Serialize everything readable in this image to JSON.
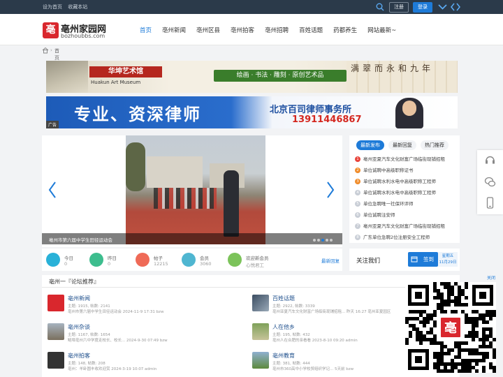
{
  "topbar": {
    "links": [
      "设为首页",
      "收藏本站"
    ],
    "register_label": "注册",
    "login_label": "登录"
  },
  "header": {
    "logo_char": "亳",
    "site_name": "亳州家园网",
    "domain": "bozhoubbs.com",
    "nav": [
      "首页",
      "亳州新闻",
      "亳州区县",
      "亳州拍客",
      "亳州招聘",
      "百姓话题",
      "药都养生",
      "网站最新~"
    ]
  },
  "breadcrumb": {
    "separator": "›",
    "current": "首页"
  },
  "banner1": {
    "brand": "华坤艺术馆",
    "brand_en": "Huakun Art Museum",
    "slogan": "绘画 · 书法 · 雕刻 · 原创艺术品",
    "calligraphy": "满翠而永和九年"
  },
  "banner2": {
    "headline": "专业、资深律师",
    "firm": "北京百司律师事务所",
    "phone": "13911446867",
    "ad_tag": "广告"
  },
  "carousel": {
    "caption": "亳州市第六届中学生田径运动会"
  },
  "stats": [
    {
      "label": "今日",
      "value": "0",
      "color": "#29b1d8"
    },
    {
      "label": "昨日",
      "value": "0",
      "color": "#3dbd8e"
    },
    {
      "label": "帖子",
      "value": "12215",
      "color": "#ef6a57"
    },
    {
      "label": "会员",
      "value": "3060",
      "color": "#4fb6d1"
    },
    {
      "label": "欢迎新会员",
      "value": "心悦君工",
      "color": "#7cc35a"
    }
  ],
  "stats_link": "最新回复",
  "right_panel": {
    "tabs": [
      "最新发布",
      "最新回复",
      "热门推荐"
    ],
    "items": [
      "亳州亚夏汽车文化财富广场临街现铺招租",
      "单位诚聘中高级职称证书",
      "单位诚聘水利水电中高级职称工程师",
      "单位诚聘水利水电中高级职称工程师",
      "单位急聘唯一社保环评师",
      "单位诚聘注安师",
      "亳州亚夏汽车文化财富广场临街现铺招租",
      "广东单位急聘2位注册安全工程师"
    ]
  },
  "follow": {
    "title": "关注我们",
    "signin_label": "签到",
    "weekday": "星期五",
    "date": "11月29日"
  },
  "forum": {
    "heading": "亳州一『论坛推荐』",
    "items": [
      {
        "title": "亳州新闻",
        "meta": "主题: 1915, 帖数: 2141",
        "last": "亳州市第六届中学生田径运动会 2024-11-9 17:31 bzw"
      },
      {
        "title": "百姓话题",
        "meta": "主题: 2922, 帖数: 3339",
        "last": "亳州亚夏汽车文化财富广场临街现铺招租... 昨天 16:27 亳州亚夏园区"
      },
      {
        "title": "亳州杂谈",
        "meta": "主题: 1167, 帖数: 1654",
        "last": "鲢埠亳州六中学度走校长、校长... 2024-9-30 07:49 bzw"
      },
      {
        "title": "人在他乡",
        "meta": "主题: 195, 帖数: 432",
        "last": "亳州人在合肥的亲看看 2023-8-10 09:20 admin"
      },
      {
        "title": "亳州拍客",
        "meta": "主题: 148, 帖数: 208",
        "last": "亳州：羊卧圆丰收欢迎赏 2024-3-19 10:07 admin"
      },
      {
        "title": "亳州教育",
        "meta": "主题: 381, 帖数: 444",
        "last": "亳州市360高中小学校贸组织学记... 5天前 bzw"
      }
    ]
  },
  "qr": {
    "close_label": "关闭",
    "logo_char": "亳"
  }
}
